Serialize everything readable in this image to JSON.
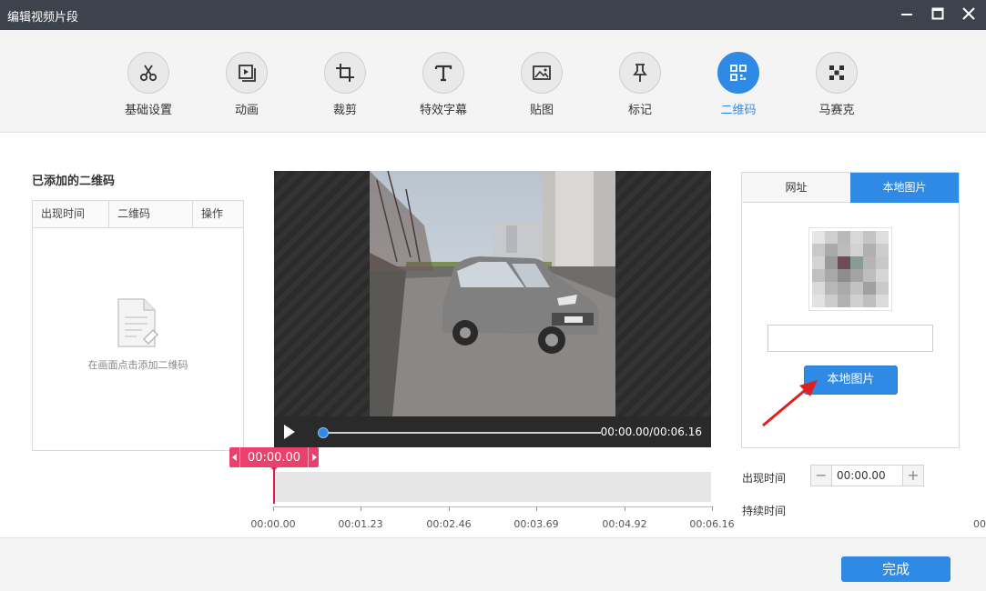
{
  "window": {
    "title": "编辑视频片段"
  },
  "toolbar": {
    "items": [
      {
        "label": "基础设置",
        "icon": "scissors-icon"
      },
      {
        "label": "动画",
        "icon": "animation-icon"
      },
      {
        "label": "裁剪",
        "icon": "crop-icon"
      },
      {
        "label": "特效字幕",
        "icon": "text-icon"
      },
      {
        "label": "贴图",
        "icon": "image-icon"
      },
      {
        "label": "标记",
        "icon": "pin-icon"
      },
      {
        "label": "二维码",
        "icon": "qrcode-icon",
        "active": true
      },
      {
        "label": "马赛克",
        "icon": "mosaic-icon"
      }
    ]
  },
  "left_panel": {
    "title": "已添加的二维码",
    "columns": [
      "出现时间",
      "二维码",
      "操作"
    ],
    "empty_text": "在画面点击添加二维码"
  },
  "player": {
    "time": "00:00.00/00:06.16",
    "progress": 0
  },
  "timeline": {
    "marker_time": "00:00.00",
    "ticks": [
      "00:00.00",
      "00:01.23",
      "00:02.46",
      "00:03.69",
      "00:04.92",
      "00:06.16"
    ],
    "edge_label": "00"
  },
  "right_panel": {
    "tab_url": "网址",
    "tab_local": "本地图片",
    "active_tab": "本地图片",
    "url_value": "",
    "local_button": "本地图片",
    "appear_label": "出现时间",
    "appear_value": "00:00.00",
    "minus": "−",
    "plus": "+",
    "duration_label": "持续时间"
  },
  "footer": {
    "done_label": "完成"
  },
  "colors": {
    "accent": "#2f8ae5",
    "marker": "#e8416b",
    "titlebar": "#3d434c"
  }
}
